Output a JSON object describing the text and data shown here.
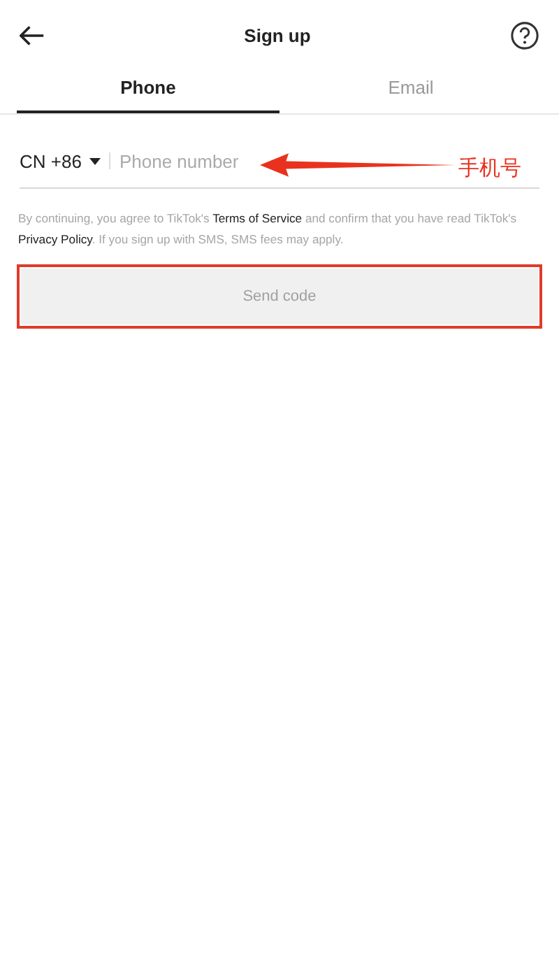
{
  "header": {
    "title": "Sign up"
  },
  "tabs": [
    {
      "label": "Phone",
      "selected": true
    },
    {
      "label": "Email",
      "selected": false
    }
  ],
  "phone": {
    "country": "CN +86",
    "placeholder": "Phone number"
  },
  "consent": [
    {
      "kind": "text",
      "text": "By continuing, you agree to TikTok's"
    },
    {
      "kind": "link",
      "text": "Terms of Service"
    },
    {
      "kind": "text",
      "text": "and confirm that you have read TikTok's"
    },
    {
      "kind": "link",
      "text": "Privacy Policy"
    },
    {
      "kind": "text",
      "text": ". If you sign up with SMS, SMS fees may apply."
    }
  ],
  "send_button": {
    "label": "Send code",
    "disabled": true
  },
  "annotation": {
    "label": "手机号"
  }
}
